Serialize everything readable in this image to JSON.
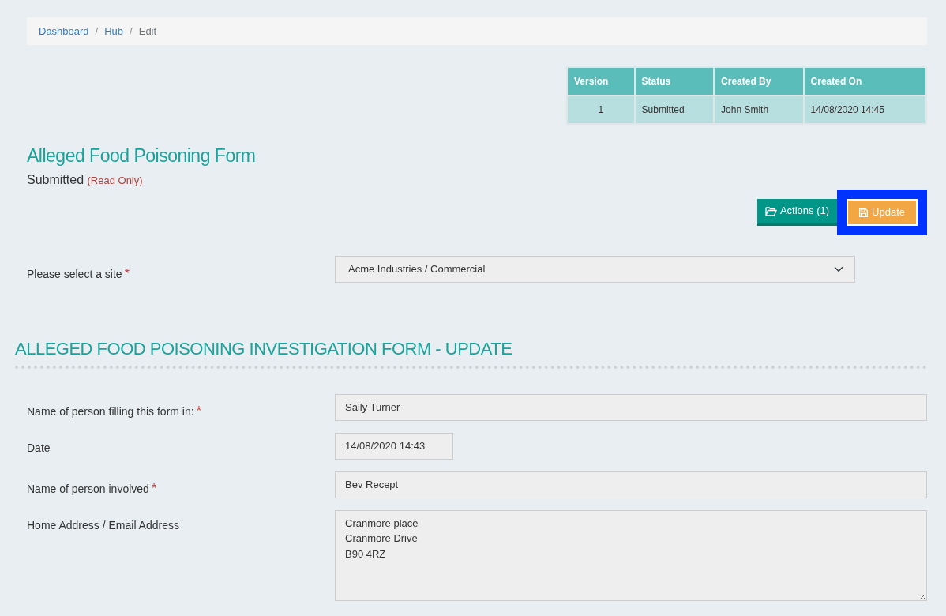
{
  "breadcrumb": [
    {
      "kind": "crumb",
      "label": "Dashboard",
      "link": true
    },
    {
      "kind": "separator",
      "label": "/"
    },
    {
      "kind": "crumb",
      "label": "Hub",
      "link": true
    },
    {
      "kind": "separator",
      "label": "/"
    },
    {
      "kind": "crumb",
      "label": "Edit",
      "link": false
    }
  ],
  "versions_table": {
    "columns": [
      "Version",
      "Status",
      "Created By",
      "Created On"
    ],
    "rows": [
      [
        "1",
        "Submitted",
        "John Smith",
        "14/08/2020 14:45"
      ]
    ]
  },
  "form_title": "Alleged Food Poisoning Form",
  "status": "Submitted",
  "status_note": "(Read Only)",
  "buttons": [
    {
      "kind": "actions",
      "label": "Actions (1)",
      "highlighted": false
    },
    {
      "kind": "update",
      "label": "Update",
      "highlighted": true
    }
  ],
  "site": {
    "label": "Please select a site",
    "required_mark": "*",
    "value": "Acme Industries / Commercial"
  },
  "section_title": "ALLEGED FOOD POISONING INVESTIGATION FORM - UPDATE",
  "fields": [
    {
      "kind": "text",
      "label": "Name of person filling this form in:",
      "required_mark": "*",
      "value": "Sally Turner"
    },
    {
      "kind": "date",
      "label": "Date",
      "value": "14/08/2020 14:43"
    },
    {
      "kind": "text",
      "label": "Name of person involved",
      "required_mark": "*",
      "value": "Bev Recept"
    },
    {
      "kind": "textarea",
      "label": "Home Address / Email Address",
      "value": "Cranmore place\nCranmore Drive\nB90 4RZ"
    }
  ]
}
